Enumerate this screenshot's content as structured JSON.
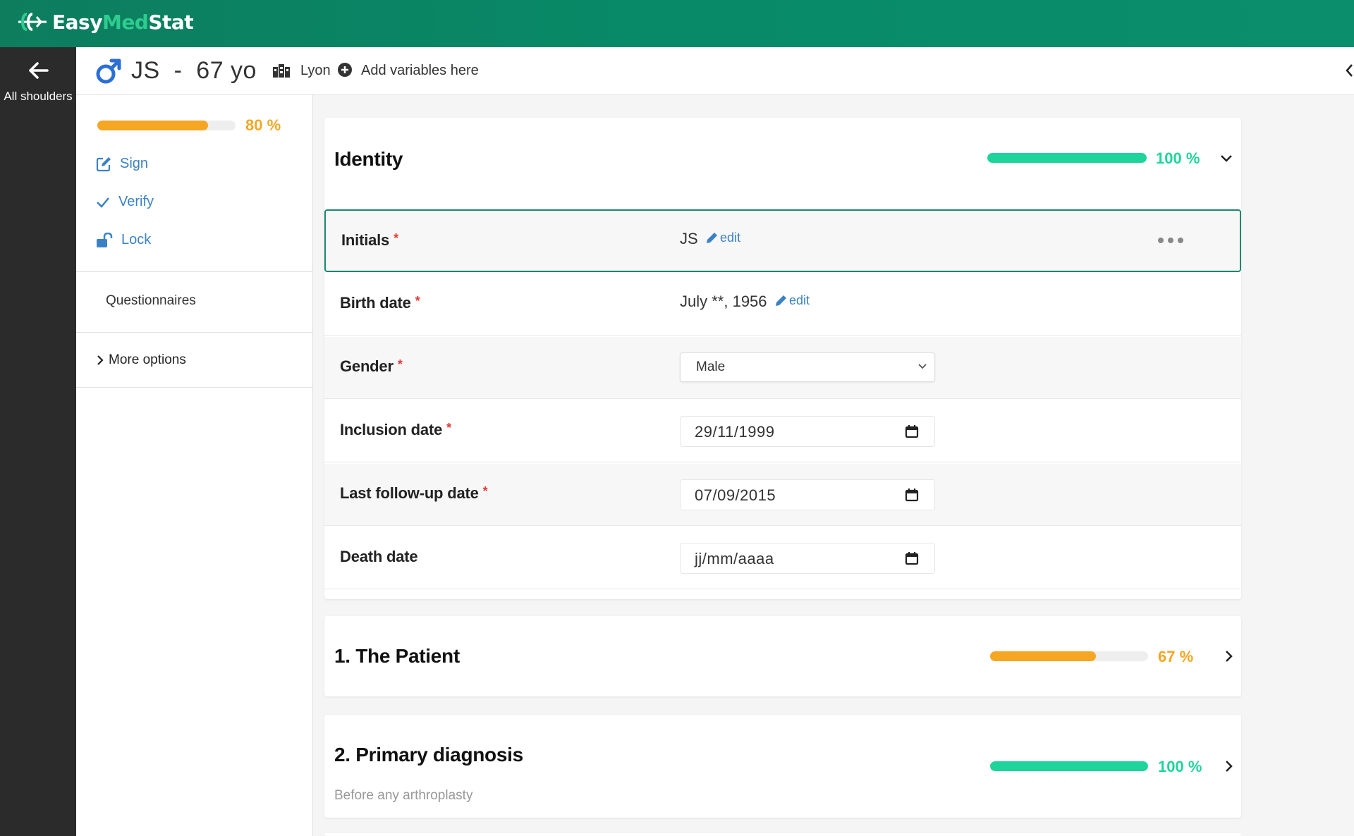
{
  "app": {
    "brand_a": "Easy",
    "brand_b": "Med",
    "brand_c": "Stat"
  },
  "rail": {
    "back_label": "All shoulders"
  },
  "header": {
    "patient": "JS  -  67 yo",
    "gender_icon": "male-symbol-icon",
    "site": "Lyon",
    "add_variables": "Add variables here"
  },
  "sidebar": {
    "progress": 0.8,
    "progress_label": "80 %",
    "actions": [
      {
        "label": "Sign",
        "icon": "edit-icon"
      },
      {
        "label": "Verify",
        "icon": "check-icon"
      },
      {
        "label": "Lock",
        "icon": "unlock-icon"
      }
    ],
    "questionnaires": "Questionnaires",
    "more_options": "More options"
  },
  "identity": {
    "title": "Identity",
    "progress": 1.0,
    "progress_label": "100 %",
    "rows": {
      "initials": {
        "label": "Initials",
        "value": "JS",
        "edit": "edit"
      },
      "birth_date": {
        "label": "Birth date",
        "value": "July **, 1956",
        "edit": "edit"
      },
      "gender": {
        "label": "Gender",
        "value": "Male"
      },
      "inclusion_date": {
        "label": "Inclusion date",
        "value": "29/11/1999"
      },
      "last_followup": {
        "label": "Last follow-up date",
        "value": "07/09/2015"
      },
      "death_date": {
        "label": "Death date",
        "placeholder": "jj/mm/aaaa"
      }
    },
    "required_marker": "*"
  },
  "sections": [
    {
      "title": "1. The Patient",
      "progress": 0.67,
      "progress_label": "67 %",
      "color": "#f5a623"
    },
    {
      "title": "2. Primary diagnosis",
      "subtitle": "Before any arthroplasty",
      "progress": 1.0,
      "progress_label": "100 %",
      "color": "#1fd49b"
    }
  ],
  "colors": {
    "header_green": "#0d7d5e",
    "accent_green": "#1fd49b",
    "accent_orange": "#f5a623",
    "link_blue": "#3b82c4",
    "required_red": "#e53935"
  }
}
